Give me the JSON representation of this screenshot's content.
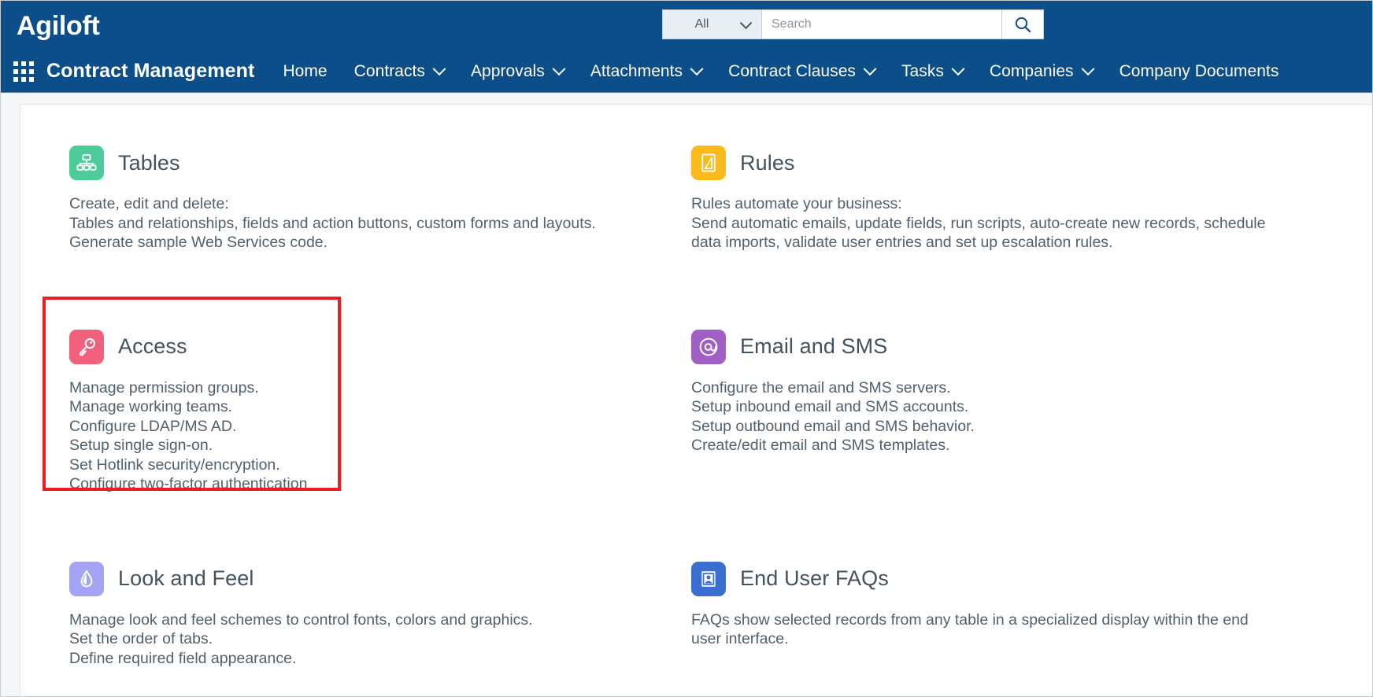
{
  "header": {
    "brand": "Agiloft",
    "search": {
      "scope_label": "All",
      "placeholder": "Search",
      "value": "",
      "button_icon": "search-icon"
    }
  },
  "nav": {
    "apps_icon": "apps-grid-icon",
    "title": "Contract Management",
    "items": [
      {
        "label": "Home",
        "has_menu": false
      },
      {
        "label": "Contracts",
        "has_menu": true
      },
      {
        "label": "Approvals",
        "has_menu": true
      },
      {
        "label": "Attachments",
        "has_menu": true
      },
      {
        "label": "Contract Clauses",
        "has_menu": true
      },
      {
        "label": "Tasks",
        "has_menu": true
      },
      {
        "label": "Companies",
        "has_menu": true
      },
      {
        "label": "Company Documents",
        "has_menu": false
      }
    ]
  },
  "colors": {
    "header_blue": "#0b4e8a",
    "tables_tile": "#4ecb9b",
    "rules_tile": "#fcbb1b",
    "access_tile": "#f1607d",
    "email_tile": "#a濾"
  },
  "blocks": [
    {
      "key": "tables",
      "title": "Tables",
      "icon": "hierarchy-icon",
      "tile_color": "#4ecb9b",
      "lines": [
        "Create, edit and delete:",
        "Tables and relationships, fields and action buttons, custom forms and layouts.",
        "Generate sample Web Services code."
      ]
    },
    {
      "key": "rules",
      "title": "Rules",
      "icon": "rules-chart-icon",
      "tile_color": "#fcbb1b",
      "lines": [
        "Rules automate your business:",
        "Send automatic emails, update fields, run scripts, auto-create new records, schedule",
        "data imports, validate user entries and set up escalation rules."
      ]
    },
    {
      "key": "access",
      "title": "Access",
      "icon": "key-icon",
      "tile_color": "#f1607d",
      "highlighted": true,
      "lines": [
        "Manage permission groups.",
        "Manage working teams.",
        "Configure LDAP/MS AD.",
        "Setup single sign-on.",
        "Set Hotlink security/encryption.",
        "Configure two-factor authentication"
      ]
    },
    {
      "key": "email-and-sms",
      "title": "Email and SMS",
      "icon": "at-sign-icon",
      "tile_color": "#a05fc4",
      "lines": [
        "Configure the email and SMS servers.",
        "Setup inbound email and SMS accounts.",
        "Setup outbound email and SMS behavior.",
        "Create/edit email and SMS templates."
      ]
    },
    {
      "key": "look-and-feel",
      "title": "Look and Feel",
      "icon": "droplet-icon",
      "tile_color": "#a3a4f3",
      "lines": [
        "Manage look and feel schemes to control fonts, colors and graphics.",
        "Set the order of tabs.",
        "Define required field appearance."
      ]
    },
    {
      "key": "end-user-faqs",
      "title": "End User FAQs",
      "icon": "user-card-icon",
      "tile_color": "#3a6fd0",
      "lines": [
        "FAQs show selected records from any table in a specialized display within the end",
        "user interface."
      ]
    }
  ]
}
